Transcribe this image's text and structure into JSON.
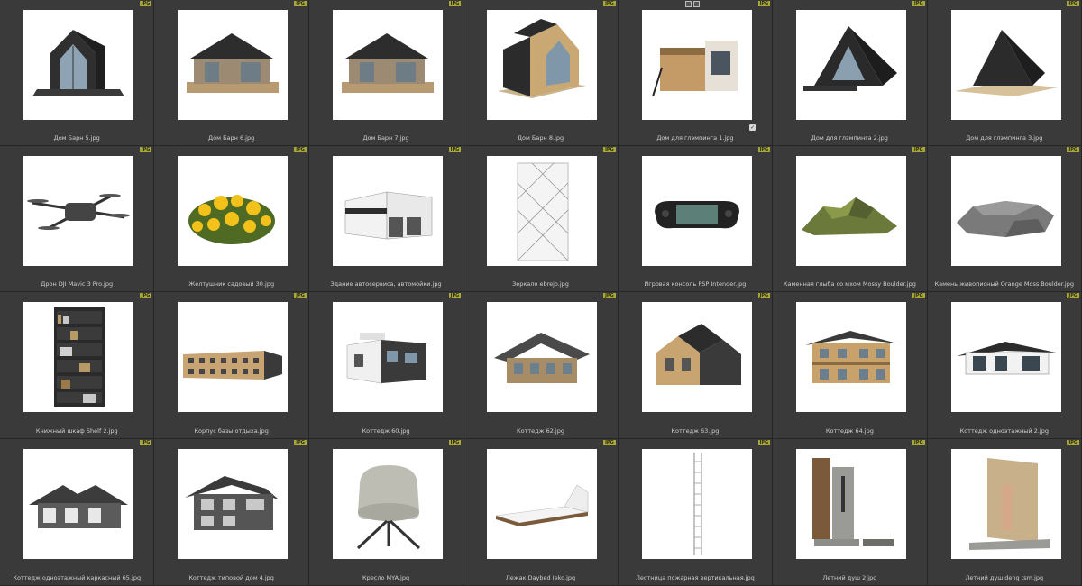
{
  "badge": "JPG",
  "items": [
    {
      "name": "Дом Барн 5.jpg",
      "icon": "barn-dark"
    },
    {
      "name": "Дом Барн 6.jpg",
      "icon": "barn-wood"
    },
    {
      "name": "Дом Барн 7.jpg",
      "icon": "barn-wood"
    },
    {
      "name": "Дом Барн 8.jpg",
      "icon": "barn-mixed"
    },
    {
      "name": "Дом для глэмпинга 1.jpg",
      "icon": "glamping-cube"
    },
    {
      "name": "Дом для глэмпинга 2.jpg",
      "icon": "a-frame"
    },
    {
      "name": "Дом для глэмпинга 3.jpg",
      "icon": "a-frame-deck"
    },
    {
      "name": "Дрон DJI Mavic 3 Pro.jpg",
      "icon": "drone"
    },
    {
      "name": "Желтушник садовый 30.jpg",
      "icon": "yellow-bush"
    },
    {
      "name": "Здание автосервиса, автомойки.jpg",
      "icon": "service-building"
    },
    {
      "name": "Зеркало ebrejo.jpg",
      "icon": "mirror-panel"
    },
    {
      "name": "Игровая консоль PSP Intender.jpg",
      "icon": "game-console"
    },
    {
      "name": "Каменная глыба со мхом Mossy Boulder.jpg",
      "icon": "mossy-rock"
    },
    {
      "name": "Камень живописный Orange Moss Boulder.jpg",
      "icon": "grey-rock"
    },
    {
      "name": "Книжный шкаф Shelf 2.jpg",
      "icon": "bookshelf"
    },
    {
      "name": "Корпус базы отдыха.jpg",
      "icon": "long-building"
    },
    {
      "name": "Коттедж 60.jpg",
      "icon": "modern-cottage"
    },
    {
      "name": "Коттедж 62.jpg",
      "icon": "chalet"
    },
    {
      "name": "Коттедж 63.jpg",
      "icon": "barn-cottage"
    },
    {
      "name": "Коттедж 64.jpg",
      "icon": "two-storey-cottage"
    },
    {
      "name": "Коттедж одноэтажный 2.jpg",
      "icon": "one-storey-dark"
    },
    {
      "name": "Коттедж одноэтажный каркасный 65.jpg",
      "icon": "frame-cottage"
    },
    {
      "name": "Коттедж типовой дом 4.jpg",
      "icon": "typical-house"
    },
    {
      "name": "Кресло MYA.jpg",
      "icon": "armchair"
    },
    {
      "name": "Лежак Daybed Ieko.jpg",
      "icon": "daybed"
    },
    {
      "name": "Лестница пожарная вертикальная.jpg",
      "icon": "fire-ladder"
    },
    {
      "name": "Летний душ 2.jpg",
      "icon": "outdoor-shower"
    },
    {
      "name": "Летний душ deng tsm.jpg",
      "icon": "shower-figure"
    }
  ]
}
